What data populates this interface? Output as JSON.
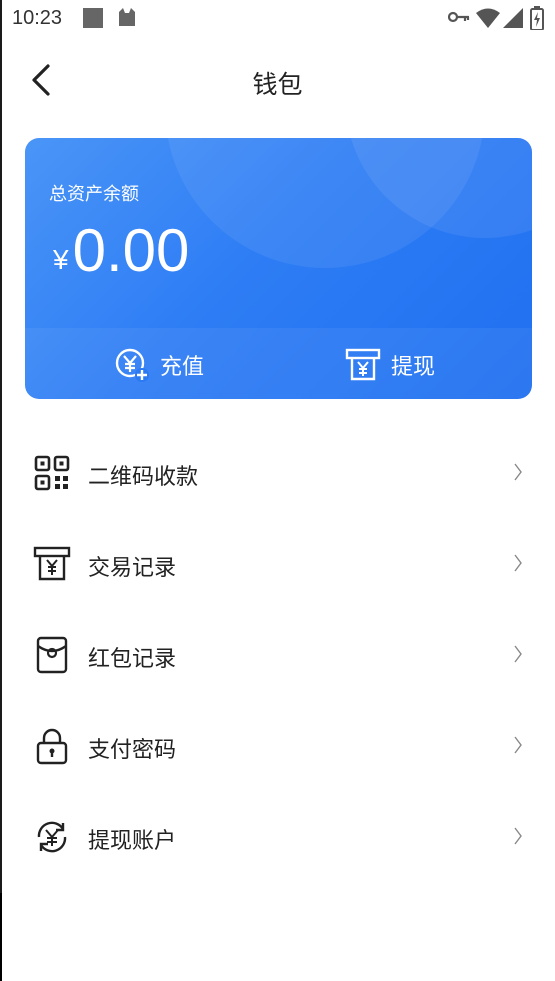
{
  "status_bar": {
    "time": "10:23"
  },
  "header": {
    "title": "钱包"
  },
  "card": {
    "label": "总资产余额",
    "currency": "¥",
    "amount": "0.00",
    "recharge_label": "充值",
    "withdraw_label": "提现"
  },
  "menu": {
    "items": [
      {
        "label": "二维码收款",
        "icon": "qr-code-icon"
      },
      {
        "label": "交易记录",
        "icon": "receipt-yuan-icon"
      },
      {
        "label": "红包记录",
        "icon": "red-packet-icon"
      },
      {
        "label": "支付密码",
        "icon": "lock-icon"
      },
      {
        "label": "提现账户",
        "icon": "yuan-cycle-icon"
      }
    ]
  },
  "colors": {
    "card_start": "#4a95f7",
    "card_end": "#1f6ff0",
    "text": "#222222"
  }
}
